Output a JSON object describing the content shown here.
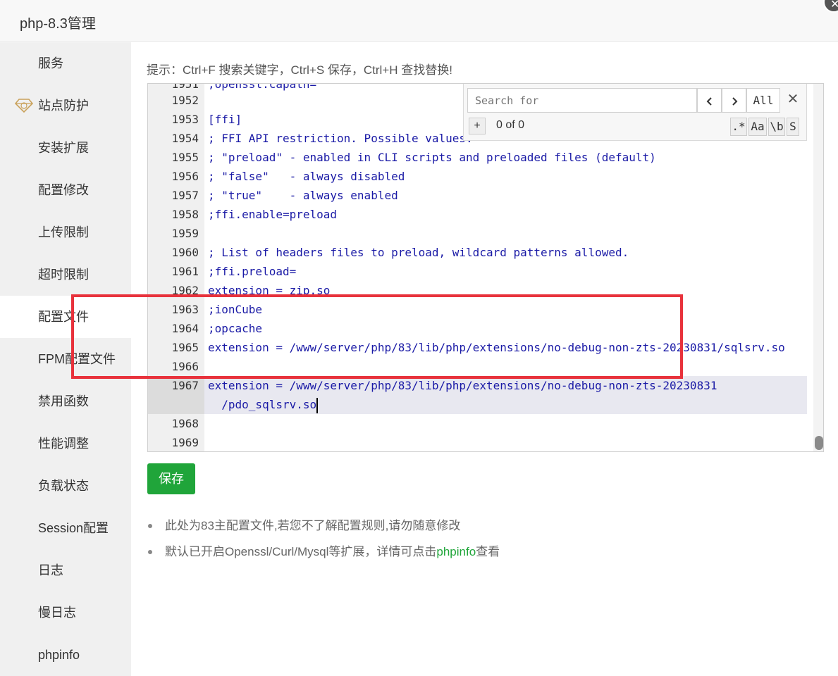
{
  "window": {
    "title": "php-8.3管理",
    "close_icon": "close-icon"
  },
  "sidebar": {
    "items": [
      {
        "label": "服务"
      },
      {
        "label": "站点防护",
        "icon": "gem-icon"
      },
      {
        "label": "安装扩展"
      },
      {
        "label": "配置修改"
      },
      {
        "label": "上传限制"
      },
      {
        "label": "超时限制"
      },
      {
        "label": "配置文件",
        "active": true
      },
      {
        "label": "FPM配置文件"
      },
      {
        "label": "禁用函数"
      },
      {
        "label": "性能调整"
      },
      {
        "label": "负载状态"
      },
      {
        "label": "Session配置"
      },
      {
        "label": "日志"
      },
      {
        "label": "慢日志"
      },
      {
        "label": "phpinfo"
      }
    ]
  },
  "main": {
    "tip": "提示：Ctrl+F 搜索关键字，Ctrl+S 保存，Ctrl+H 查找替换!",
    "search": {
      "placeholder": "Search for",
      "all_label": "All",
      "count": "0 of 0",
      "plus": "+",
      "opt_regex": ".*",
      "opt_case": "Aa",
      "opt_word": "\\b",
      "opt_selection": "S"
    },
    "editor": {
      "partial_top": ";openssl.capath=",
      "lines": [
        {
          "n": "1952",
          "t": ""
        },
        {
          "n": "1953",
          "t": "[ffi]"
        },
        {
          "n": "1954",
          "t": "; FFI API restriction. Possible values:"
        },
        {
          "n": "1955",
          "t": "; \"preload\" - enabled in CLI scripts and preloaded files (default)"
        },
        {
          "n": "1956",
          "t": "; \"false\"   - always disabled"
        },
        {
          "n": "1957",
          "t": "; \"true\"    - always enabled"
        },
        {
          "n": "1958",
          "t": ";ffi.enable=preload"
        },
        {
          "n": "1959",
          "t": ""
        },
        {
          "n": "1960",
          "t": "; List of headers files to preload, wildcard patterns allowed."
        },
        {
          "n": "1961",
          "t": ";ffi.preload="
        },
        {
          "n": "1962",
          "t": "extension = zip.so"
        },
        {
          "n": "1963",
          "t": ";ionCube"
        },
        {
          "n": "1964",
          "t": ";opcache"
        },
        {
          "n": "1965",
          "t": "extension = /www/server/php/83/lib/php/extensions/no-debug-non-zts-20230831/sqlsrv.so"
        },
        {
          "n": "1966",
          "t": ""
        },
        {
          "n": "1967",
          "t": "extension = /www/server/php/83/lib/php/extensions/no-debug-non-zts-20230831"
        },
        {
          "n": "",
          "t": "  /pdo_sqlsrv.so"
        },
        {
          "n": "1968",
          "t": ""
        },
        {
          "n": "1969",
          "t": ""
        }
      ]
    },
    "save_label": "保存",
    "notes": {
      "note1": "此处为83主配置文件,若您不了解配置规则,请勿随意修改",
      "note2_prefix": "默认已开启Openssl/Curl/Mysql等扩展，详情可点击",
      "note2_link": "phpinfo",
      "note2_suffix": "查看"
    }
  },
  "colors": {
    "accent": "#20a53a",
    "highlight": "#e8323c",
    "code_text": "#1a1aa6"
  }
}
